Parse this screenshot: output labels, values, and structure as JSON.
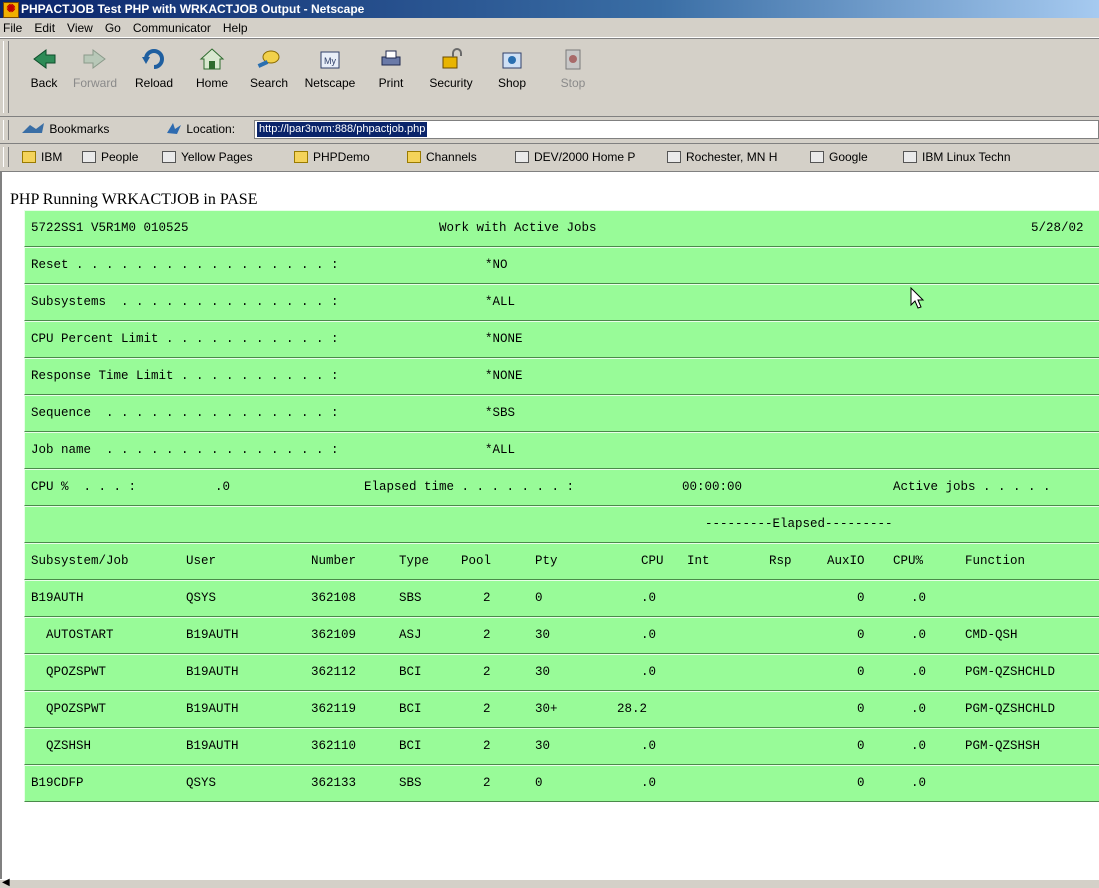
{
  "window": {
    "title": "PHPACTJOB Test PHP with WRKACTJOB Output - Netscape"
  },
  "menu": [
    "File",
    "Edit",
    "View",
    "Go",
    "Communicator",
    "Help"
  ],
  "toolbar": {
    "buttons": [
      {
        "label": "Back",
        "icon": "back-arrow-icon",
        "enabled": true
      },
      {
        "label": "Forward",
        "icon": "forward-arrow-icon",
        "enabled": false
      },
      {
        "label": "Reload",
        "icon": "reload-icon",
        "enabled": true
      },
      {
        "label": "Home",
        "icon": "home-icon",
        "enabled": true
      },
      {
        "label": "Search",
        "icon": "search-icon",
        "enabled": true
      },
      {
        "label": "Netscape",
        "icon": "netscape-icon",
        "enabled": true
      },
      {
        "label": "Print",
        "icon": "print-icon",
        "enabled": true
      },
      {
        "label": "Security",
        "icon": "security-lock-icon",
        "enabled": true
      },
      {
        "label": "Shop",
        "icon": "shop-icon",
        "enabled": true
      },
      {
        "label": "Stop",
        "icon": "stop-icon",
        "enabled": false
      }
    ]
  },
  "location": {
    "bookmarks_label": "Bookmarks",
    "location_label": "Location:",
    "url": "http://lpar3nvm:888/phpactjob.php"
  },
  "personal_toolbar": [
    {
      "label": "IBM",
      "icon": "folder-icon"
    },
    {
      "label": "People",
      "icon": "page-icon"
    },
    {
      "label": "Yellow Pages",
      "icon": "page-icon"
    },
    {
      "label": "PHPDemo",
      "icon": "folder-icon"
    },
    {
      "label": "Channels",
      "icon": "folder-icon"
    },
    {
      "label": "DEV/2000 Home P",
      "icon": "page-icon"
    },
    {
      "label": "Rochester, MN H",
      "icon": "page-icon"
    },
    {
      "label": "Google",
      "icon": "page-icon"
    },
    {
      "label": "IBM Linux Techn",
      "icon": "page-icon"
    }
  ],
  "page": {
    "title": "PHP Running WRKACTJOB in PASE",
    "header": {
      "system": "5722SS1 V5R1M0 010525",
      "screen_title": "Work with Active Jobs",
      "date": "5/28/02"
    },
    "params": [
      {
        "label": "Reset . . . . . . . . . . . . . . . . . :",
        "value": "*NO"
      },
      {
        "label": "Subsystems  . . . . . . . . . . . . . . :",
        "value": "*ALL"
      },
      {
        "label": "CPU Percent Limit . . . . . . . . . . . :",
        "value": "*NONE"
      },
      {
        "label": "Response Time Limit . . . . . . . . . . :",
        "value": "*NONE"
      },
      {
        "label": "Sequence  . . . . . . . . . . . . . . . :",
        "value": "*SBS"
      },
      {
        "label": "Job name  . . . . . . . . . . . . . . . :",
        "value": "*ALL"
      }
    ],
    "stats": {
      "cpu_label": "CPU %  . . . :",
      "cpu_value": ".0",
      "elapsed_label": "Elapsed time . . . . . . . :",
      "elapsed_value": "00:00:00",
      "active_label": "Active jobs . . . . ."
    },
    "elapsed_banner": "---------Elapsed---------",
    "columns": [
      "Subsystem/Job",
      "User",
      "Number",
      "Type",
      "Pool",
      "Pty",
      "CPU",
      "Int",
      "Rsp",
      "AuxIO",
      "CPU%",
      "Function"
    ],
    "jobs": [
      {
        "job": "B19AUTH",
        "user": "QSYS",
        "number": "362108",
        "type": "SBS",
        "pool": "2",
        "pty": "0",
        "cpu": ".0",
        "int": "",
        "rsp": "",
        "auxio": "0",
        "cpupct": ".0",
        "function": ""
      },
      {
        "job": "  AUTOSTART",
        "user": "B19AUTH",
        "number": "362109",
        "type": "ASJ",
        "pool": "2",
        "pty": "30",
        "cpu": ".0",
        "int": "",
        "rsp": "",
        "auxio": "0",
        "cpupct": ".0",
        "function": "CMD-QSH"
      },
      {
        "job": "  QPOZSPWT",
        "user": "B19AUTH",
        "number": "362112",
        "type": "BCI",
        "pool": "2",
        "pty": "30",
        "cpu": ".0",
        "int": "",
        "rsp": "",
        "auxio": "0",
        "cpupct": ".0",
        "function": "PGM-QZSHCHLD"
      },
      {
        "job": "  QPOZSPWT",
        "user": "B19AUTH",
        "number": "362119",
        "type": "BCI",
        "pool": "2",
        "pty": "30+",
        "cpu": "28.2",
        "int": "",
        "rsp": "",
        "auxio": "0",
        "cpupct": ".0",
        "function": "PGM-QZSHCHLD"
      },
      {
        "job": "  QZSHSH",
        "user": "B19AUTH",
        "number": "362110",
        "type": "BCI",
        "pool": "2",
        "pty": "30",
        "cpu": ".0",
        "int": "",
        "rsp": "",
        "auxio": "0",
        "cpupct": ".0",
        "function": "PGM-QZSHSH"
      },
      {
        "job": "B19CDFP",
        "user": "QSYS",
        "number": "362133",
        "type": "SBS",
        "pool": "2",
        "pty": "0",
        "cpu": ".0",
        "int": "",
        "rsp": "",
        "auxio": "0",
        "cpupct": ".0",
        "function": ""
      }
    ]
  }
}
